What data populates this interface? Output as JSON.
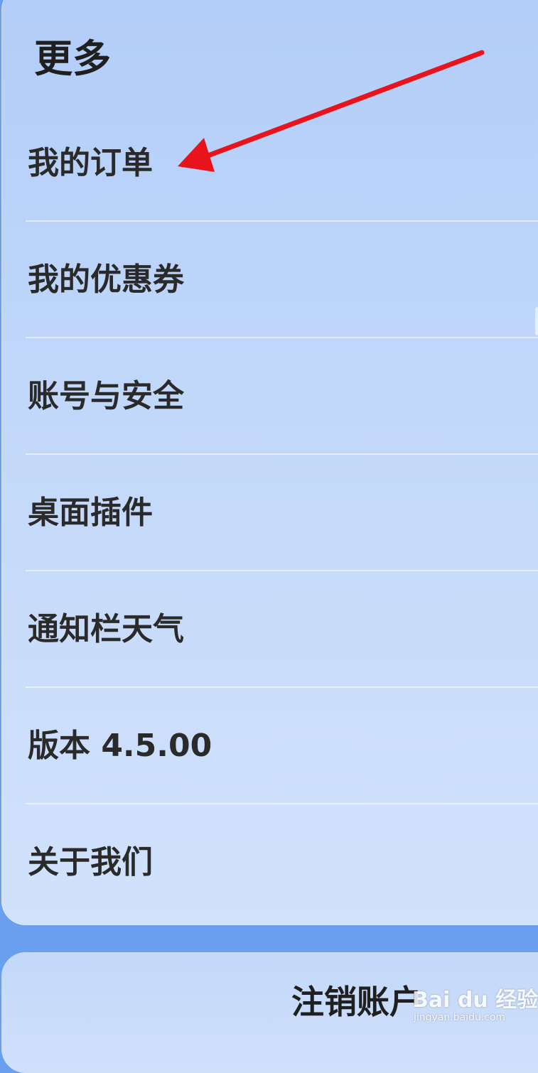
{
  "section": {
    "title": "更多"
  },
  "menu": {
    "items": [
      {
        "label": "我的订单"
      },
      {
        "label": "我的优惠券"
      },
      {
        "label": "账号与安全"
      },
      {
        "label": "桌面插件"
      },
      {
        "label": "通知栏天气"
      },
      {
        "label": "版本 4.5.00"
      },
      {
        "label": "关于我们"
      }
    ]
  },
  "account": {
    "logout_label": "注销账户"
  },
  "watermark": {
    "logo": "Bai du 经验",
    "url": "jingyan.baidu.com"
  },
  "annotation": {
    "arrow_color": "#e8131b",
    "arrow_target": "我的订单"
  },
  "colors": {
    "panel_top": "#b2cdf8",
    "panel_bottom": "#d1e2fb",
    "background": "#6a9ff0"
  }
}
